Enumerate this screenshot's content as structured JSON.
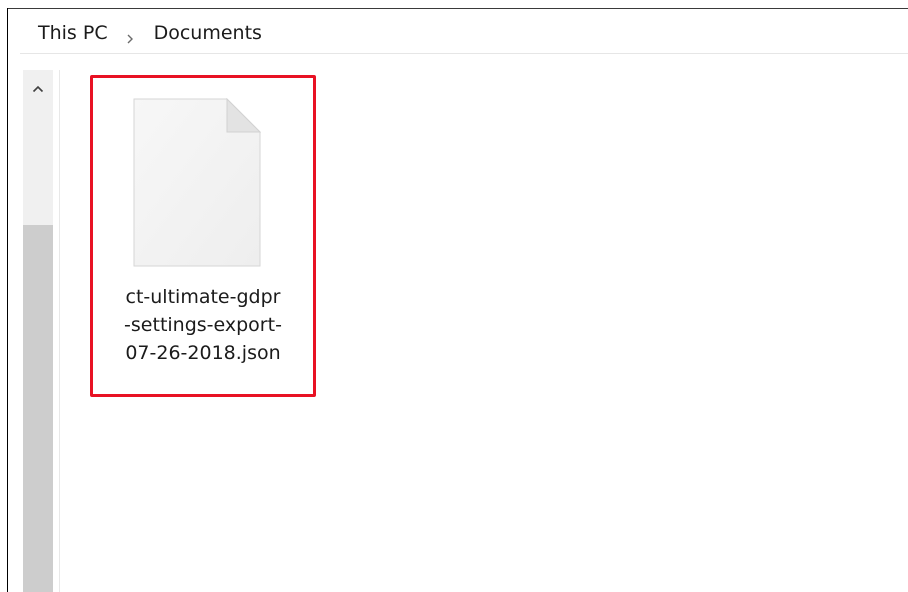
{
  "breadcrumb": {
    "items": [
      "This PC",
      "Documents"
    ],
    "separator_icon": "chevron-right-icon"
  },
  "scrollbar": {
    "up_icon": "chevron-up-icon"
  },
  "files": [
    {
      "name_lines": [
        "ct-ultimate-gdpr",
        "-settings-export-",
        "07-26-2018.json"
      ],
      "icon": "generic-file-icon",
      "selected": true,
      "highlight_color": "#e81123"
    }
  ],
  "colors": {
    "highlight": "#e81123",
    "text": "#1b1b1b",
    "scroll_track": "#f0f0f0",
    "scroll_thumb": "#cdcdcd"
  }
}
